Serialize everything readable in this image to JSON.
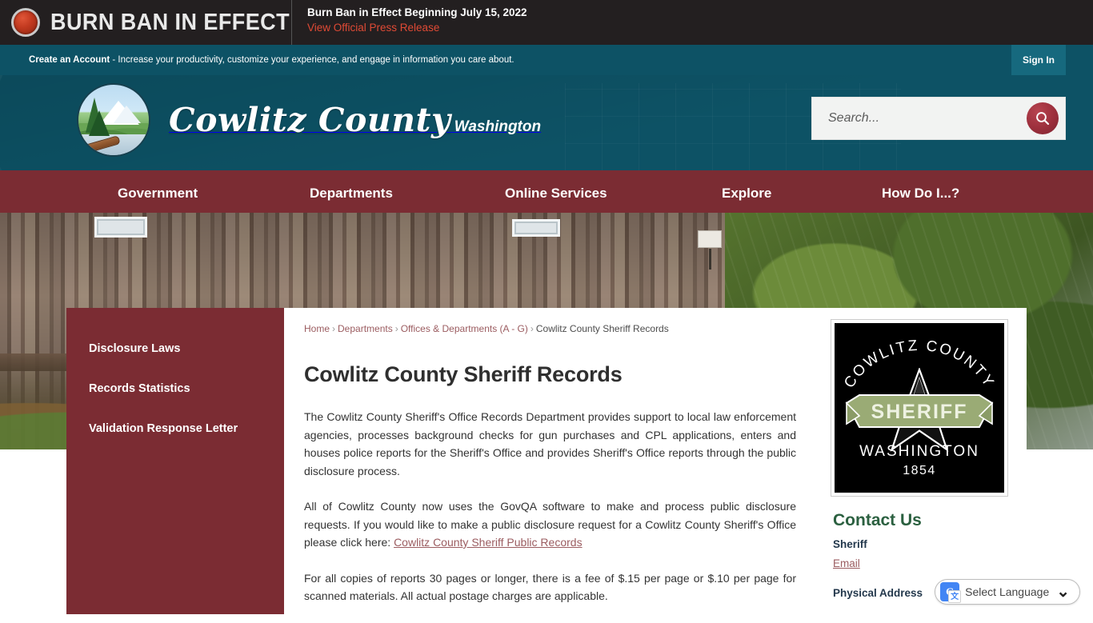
{
  "alert": {
    "icon": "red-circle-icon",
    "title": "BURN BAN IN EFFECT",
    "headline": "Burn Ban in Effect Beginning July 15, 2022",
    "link_label": "View Official Press Release",
    "bg_color": "#231f20",
    "link_color": "#e04a35"
  },
  "account_bar": {
    "link_label": "Create an Account",
    "tagline": " - Increase your productivity, customize your experience, and engage in information you care about.",
    "signin_label": "Sign In",
    "bg_color": "#0d5265"
  },
  "brand": {
    "seal_icon": "county-seal-icon",
    "county": "Cowlitz County",
    "state": "Washington",
    "bg_color": "#0d5265"
  },
  "search": {
    "placeholder": "Search...",
    "value": "",
    "button_icon": "search-icon",
    "button_color": "#9c2f3c"
  },
  "nav": {
    "bg_color": "#7b2c33",
    "items": [
      {
        "label": "Government"
      },
      {
        "label": "Departments"
      },
      {
        "label": "Online Services"
      },
      {
        "label": "Explore"
      },
      {
        "label": "How Do I...?"
      }
    ]
  },
  "sidebar": {
    "bg_color": "#7b2c33",
    "items": [
      {
        "label": "Disclosure Laws"
      },
      {
        "label": "Records Statistics"
      },
      {
        "label": "Validation Response Letter"
      }
    ]
  },
  "breadcrumb": {
    "items": [
      {
        "label": "Home",
        "link": true
      },
      {
        "label": "Departments",
        "link": true
      },
      {
        "label": "Offices & Departments (A - G)",
        "link": true
      },
      {
        "label": "Cowlitz County Sheriff Records",
        "link": false
      }
    ],
    "separator": "›"
  },
  "main": {
    "title": "Cowlitz County Sheriff Records",
    "paragraph_1": "The Cowlitz County Sheriff's Office Records Department provides support to local law enforcement agencies, processes background checks for gun purchases and CPL applications, enters and houses police reports for the Sheriff's Office and provides Sheriff's Office reports through the public disclosure process.",
    "paragraph_2_before": "All of Cowlitz County now uses the GovQA software to make and process public disclosure requests. If you would like to make a public disclosure request for a Cowlitz County Sheriff's Office please click here: ",
    "paragraph_2_link": "Cowlitz County Sheriff Public Records",
    "paragraph_3": "For all copies of reports 30 pages or longer, there is a fee of $.15 per page or $.10 per page for scanned materials. All actual postage charges are applicable."
  },
  "rail": {
    "badge": {
      "icon": "sheriff-badge-icon",
      "arc_text": "COWLITZ COUNTY",
      "ribbon_text": "SHERIFF",
      "state_text": "WASHINGTON",
      "year_text": "1854",
      "bg_color": "#000000",
      "ribbon_color": "#9aab75"
    },
    "contact_title": "Contact Us",
    "contact_name": "Sheriff",
    "email_label": "Email",
    "physical_address_label": "Physical Address"
  },
  "translate": {
    "icon": "google-translate-icon",
    "label": "Select Language",
    "caret_icon": "chevron-down-icon"
  }
}
